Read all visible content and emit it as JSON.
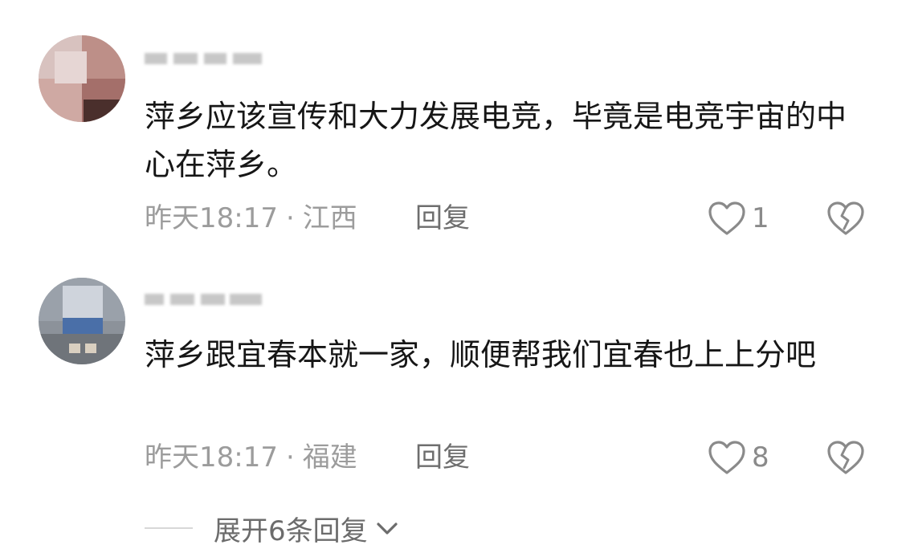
{
  "comments": [
    {
      "username": "大豪小轩",
      "text": "萍乡应该宣传和大力发展电竞，毕竟是电竞宇宙的中心在萍乡。",
      "time": "昨天18:17",
      "separator": "·",
      "location": "江西",
      "reply_label": "回复",
      "likes": "1"
    },
    {
      "username": "小王同zhi",
      "text": "萍乡跟宜春本就一家，顺便帮我们宜春也上上分吧",
      "time": "昨天18:17",
      "separator": "·",
      "location": "福建",
      "reply_label": "回复",
      "likes": "8"
    }
  ],
  "expand_replies_label": "展开6条回复",
  "icons": {
    "like": "heart-outline-icon",
    "dislike": "broken-heart-icon",
    "expand": "chevron-down-icon"
  },
  "colors": {
    "text": "#161616",
    "meta": "#9c9c9c",
    "icon": "#8a8a8a"
  }
}
